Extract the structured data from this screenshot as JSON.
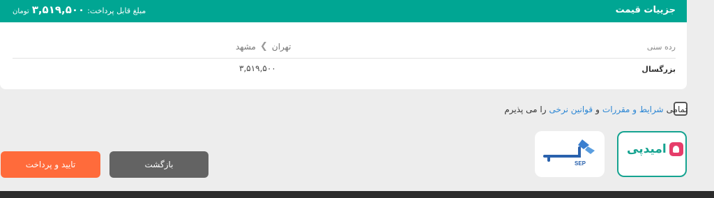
{
  "header": {
    "title": "جزییات قیمت",
    "amount_label": "مبلغ قابل پرداخت:",
    "amount_value": "۳,۵۱۹,۵۰۰",
    "amount_unit": "تومان"
  },
  "table": {
    "col_age": "رده سنی",
    "route_from": "تهران",
    "route_to": "مشهد",
    "rows": [
      {
        "age": "بزرگسال",
        "price": "۳,۵۱۹,۵۰۰"
      }
    ]
  },
  "terms": {
    "prefix": "تمامی",
    "link1": "شرایط و مقررات",
    "mid": "و",
    "link2": "قوانین نرخی",
    "suffix": "را می پذیرم"
  },
  "gateways": {
    "omid": "امیدپی",
    "sep": "SEP"
  },
  "buttons": {
    "back": "بازگشت",
    "pay": "تایید و پرداخت"
  },
  "colors": {
    "brand": "#00a693",
    "pay": "#ff6b3b",
    "link": "#2b86d4"
  }
}
